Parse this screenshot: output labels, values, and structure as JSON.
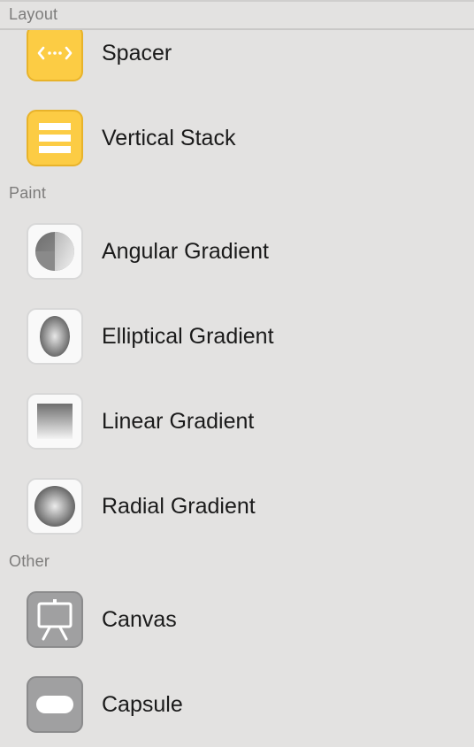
{
  "sections": {
    "layout": {
      "title": "Layout"
    },
    "paint": {
      "title": "Paint"
    },
    "other": {
      "title": "Other"
    }
  },
  "items": {
    "spacer": {
      "label": "Spacer",
      "icon": "spacer-icon"
    },
    "vertical_stack": {
      "label": "Vertical Stack",
      "icon": "vertical-stack-icon"
    },
    "angular_gradient": {
      "label": "Angular Gradient",
      "icon": "angular-gradient-icon"
    },
    "elliptical_gradient": {
      "label": "Elliptical Gradient",
      "icon": "elliptical-gradient-icon"
    },
    "linear_gradient": {
      "label": "Linear Gradient",
      "icon": "linear-gradient-icon"
    },
    "radial_gradient": {
      "label": "Radial Gradient",
      "icon": "radial-gradient-icon"
    },
    "canvas": {
      "label": "Canvas",
      "icon": "canvas-icon"
    },
    "capsule": {
      "label": "Capsule",
      "icon": "capsule-icon"
    }
  },
  "colors": {
    "layout_tile": "#fccc44",
    "paint_tile": "#f9f9f9",
    "other_tile": "#a0a0a1",
    "background": "#e3e2e1"
  }
}
